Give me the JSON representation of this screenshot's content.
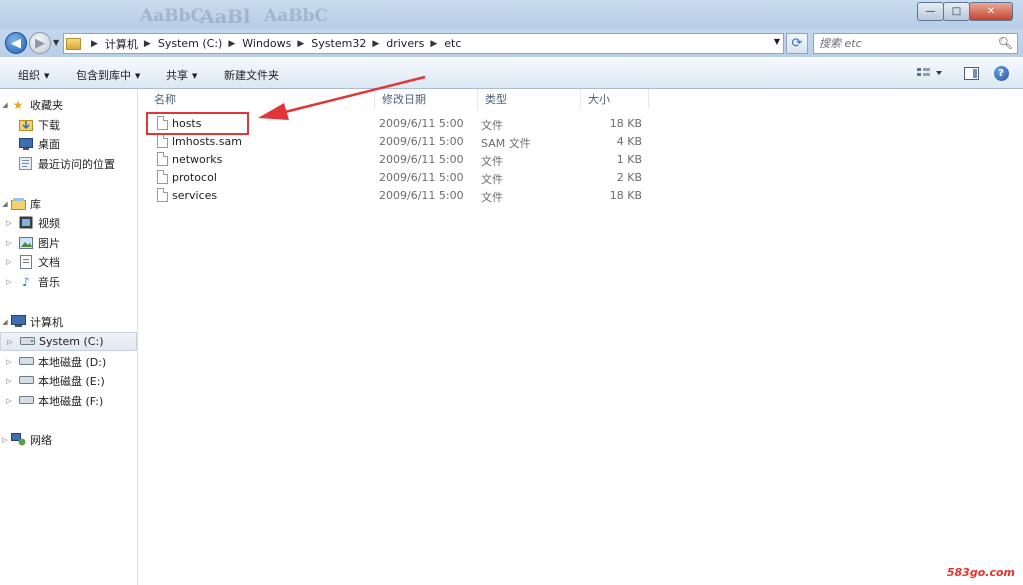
{
  "window": {
    "ghost_text": [
      "AaBbC",
      "AaBl",
      "AaBbC"
    ],
    "buttons": {
      "minimize": "—",
      "maximize": "□",
      "close": "✕"
    }
  },
  "address": {
    "crumbs": [
      "计算机",
      "System (C:)",
      "Windows",
      "System32",
      "drivers",
      "etc"
    ],
    "search_placeholder": "搜索 etc"
  },
  "toolbar": {
    "organize": "组织",
    "include_in_library": "包含到库中",
    "share": "共享",
    "new_folder": "新建文件夹"
  },
  "nav": {
    "favorites": {
      "label": "收藏夹",
      "items": [
        "下载",
        "桌面",
        "最近访问的位置"
      ]
    },
    "libraries": {
      "label": "库",
      "items": [
        "视频",
        "图片",
        "文档",
        "音乐"
      ]
    },
    "computer": {
      "label": "计算机",
      "items": [
        "System (C:)",
        "本地磁盘 (D:)",
        "本地磁盘 (E:)",
        "本地磁盘 (F:)"
      ]
    },
    "network": {
      "label": "网络"
    }
  },
  "columns": {
    "name": "名称",
    "modified": "修改日期",
    "type": "类型",
    "size": "大小"
  },
  "files": [
    {
      "name": "hosts",
      "modified": "2009/6/11 5:00",
      "type": "文件",
      "size": "18 KB"
    },
    {
      "name": "lmhosts.sam",
      "modified": "2009/6/11 5:00",
      "type": "SAM 文件",
      "size": "4 KB"
    },
    {
      "name": "networks",
      "modified": "2009/6/11 5:00",
      "type": "文件",
      "size": "1 KB"
    },
    {
      "name": "protocol",
      "modified": "2009/6/11 5:00",
      "type": "文件",
      "size": "2 KB"
    },
    {
      "name": "services",
      "modified": "2009/6/11 5:00",
      "type": "文件",
      "size": "18 KB"
    }
  ],
  "watermark": "583go.com",
  "colors": {
    "highlight_box": "#e0363a",
    "accent_blue": "#215fb3"
  }
}
